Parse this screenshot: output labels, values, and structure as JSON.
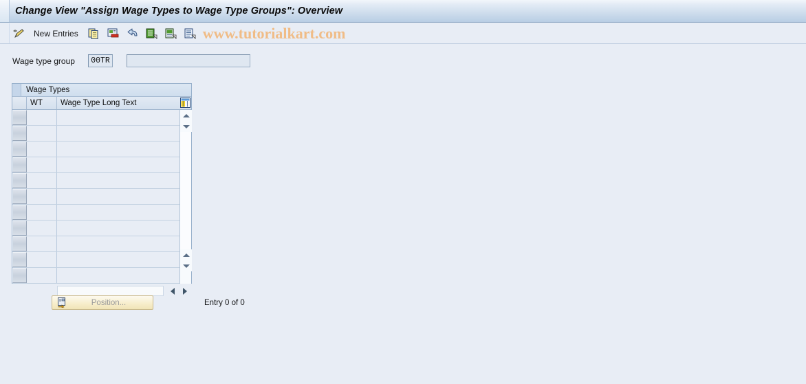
{
  "window": {
    "title": "Change View \"Assign Wage Types to Wage Type Groups\": Overview"
  },
  "toolbar": {
    "new_entries_label": "New Entries",
    "watermark": "www.tutorialkart.com",
    "icons": [
      {
        "name": "display-change-pencil-icon"
      },
      {
        "name": "copy-icon"
      },
      {
        "name": "delete-icon"
      },
      {
        "name": "undo-icon"
      },
      {
        "name": "select-all-icon"
      },
      {
        "name": "deselect-all-icon"
      },
      {
        "name": "details-icon"
      }
    ]
  },
  "fields": {
    "wage_type_group_label": "Wage type group",
    "wage_type_group_key": "00TR",
    "wage_type_group_desc": ""
  },
  "table": {
    "panel_title": "Wage Types",
    "columns": [
      {
        "key": "wt",
        "label": "WT"
      },
      {
        "key": "long_text",
        "label": "Wage Type Long Text"
      }
    ],
    "config_icon": "table-settings-icon",
    "rows": [
      {
        "wt": "",
        "long_text": ""
      },
      {
        "wt": "",
        "long_text": ""
      },
      {
        "wt": "",
        "long_text": ""
      },
      {
        "wt": "",
        "long_text": ""
      },
      {
        "wt": "",
        "long_text": ""
      },
      {
        "wt": "",
        "long_text": ""
      },
      {
        "wt": "",
        "long_text": ""
      },
      {
        "wt": "",
        "long_text": ""
      },
      {
        "wt": "",
        "long_text": ""
      },
      {
        "wt": "",
        "long_text": ""
      },
      {
        "wt": "",
        "long_text": ""
      }
    ]
  },
  "footer": {
    "position_label": "Position...",
    "entry_counter": "Entry 0 of 0"
  },
  "colors": {
    "page_background": "#e8edf5",
    "titlebar_gradient_top": "#f2f6fb",
    "titlebar_gradient_bottom": "#b9cee4",
    "panel_border": "#97b0cb",
    "watermark": "#f0bc86",
    "button_yellow": "#f7eecd"
  }
}
